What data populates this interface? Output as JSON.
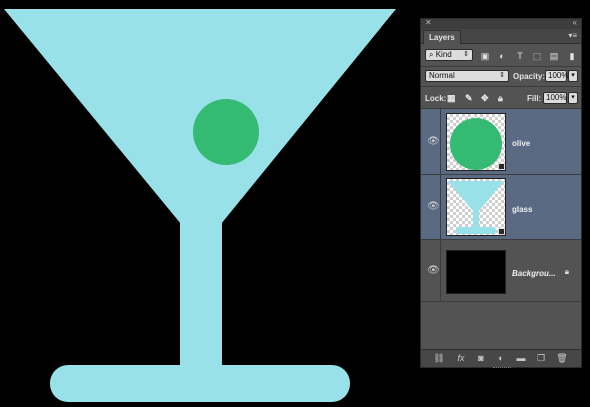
{
  "panel": {
    "title": "Layers",
    "filter": {
      "kind_label": "Kind"
    },
    "blend_mode": "Normal",
    "opacity_label": "Opacity:",
    "opacity_value": "100%",
    "lock_label": "Lock:",
    "fill_label": "Fill:",
    "fill_value": "100%"
  },
  "layers": [
    {
      "name": "olive",
      "selected": true
    },
    {
      "name": "glass",
      "selected": true
    },
    {
      "name": "Backgrou...",
      "selected": false,
      "locked": true
    }
  ],
  "colors": {
    "glass": "#98e1e8",
    "olive": "#34ba72",
    "canvas_background": "#000000",
    "panel": "#535353",
    "selected_layer": "#5a6a82"
  },
  "icons": {
    "filter_icons": [
      "image-filter-icon",
      "adjustment-filter-icon",
      "type-filter-icon",
      "shape-filter-icon",
      "smart-object-filter-icon",
      "filter-toggle-icon"
    ],
    "lock_icons": [
      "lock-pixels-icon",
      "lock-paint-icon",
      "lock-position-icon",
      "lock-all-icon"
    ],
    "footer_icons": [
      "link-layers-icon",
      "fx-icon",
      "mask-icon",
      "adjustment-layer-icon",
      "group-icon",
      "new-layer-icon",
      "trash-icon"
    ]
  }
}
